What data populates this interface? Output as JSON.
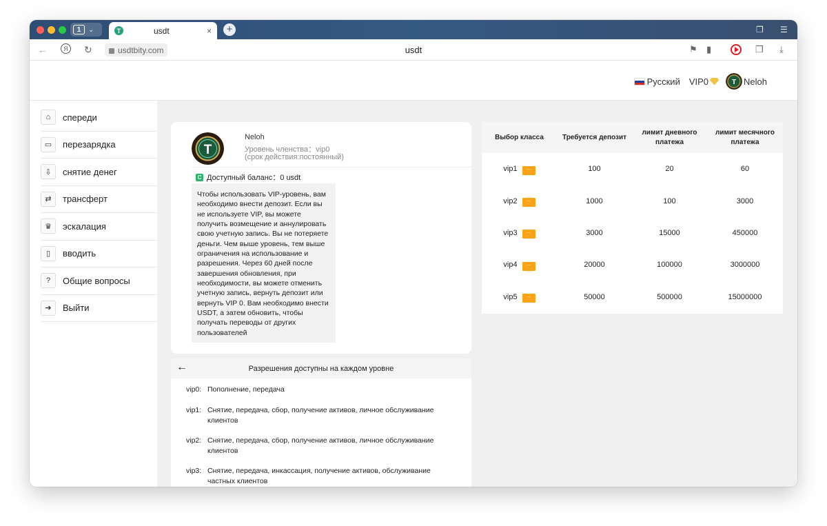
{
  "browser": {
    "tab_count": "1",
    "tab_title": "usdt",
    "tab_close": "×",
    "new_tab": "+",
    "url": "usdtbity.com",
    "center_title": "usdt"
  },
  "header": {
    "language": "Русский",
    "vip_level": "VIP0",
    "username": "Neloh"
  },
  "sidebar": {
    "items": [
      {
        "label": "спереди",
        "icon": "home-icon"
      },
      {
        "label": "перезарядка",
        "icon": "wallet-icon"
      },
      {
        "label": "снятие денег",
        "icon": "tray-download-icon"
      },
      {
        "label": "трансферт",
        "icon": "transfer-icon"
      },
      {
        "label": "эскалация",
        "icon": "crown-icon"
      },
      {
        "label": "вводить",
        "icon": "document-icon"
      },
      {
        "label": "Общие вопросы",
        "icon": "question-icon"
      },
      {
        "label": "Выйти",
        "icon": "logout-icon"
      }
    ]
  },
  "profile": {
    "name": "Neloh",
    "level": "Уровень членства：vip0",
    "expiry": "(срок действия:постоянный)",
    "balance": "Доступный баланс：0 usdt",
    "info": "Чтобы использовать VIP-уровень, вам необходимо внести депозит. Если вы не используете VIP, вы можете получить возмещение и аннулировать свою учетную запись. Вы не потеряете деньги. Чем выше уровень, тем выше ограничения на использование и разрешения. Через 60 дней после завершения обновления, при необходимости, вы можете отменить учетную запись, вернуть депозит или вернуть VIP 0. Вам необходимо внести USDT, а затем обновить, чтобы получать переводы от других пользователей"
  },
  "permissions": {
    "title": "Разрешения доступны на каждом уровне",
    "rows": [
      {
        "level": "vip0:",
        "text": "Пополнение, передача"
      },
      {
        "level": "vip1:",
        "text": "Снятие, передача, сбор, получение активов, личное обслуживание клиентов"
      },
      {
        "level": "vip2:",
        "text": "Снятие, передача, сбор, получение активов, личное обслуживание клиентов"
      },
      {
        "level": "vip3:",
        "text": "Снятие, передача, инкассация, получение активов, обслуживание частных клиентов"
      }
    ]
  },
  "vip_table": {
    "headers": [
      "Выбор класса",
      "Требуется депозит",
      "лимит дневного платежа",
      "лимит месячного платежа"
    ],
    "button_label": "...",
    "rows": [
      {
        "level": "vip1",
        "deposit": "100",
        "daily": "20",
        "monthly": "60"
      },
      {
        "level": "vip2",
        "deposit": "1000",
        "daily": "100",
        "monthly": "3000"
      },
      {
        "level": "vip3",
        "deposit": "3000",
        "daily": "15000",
        "monthly": "450000"
      },
      {
        "level": "vip4",
        "deposit": "20000",
        "daily": "100000",
        "monthly": "3000000"
      },
      {
        "level": "vip5",
        "deposit": "50000",
        "daily": "500000",
        "monthly": "15000000"
      }
    ]
  },
  "colors": {
    "accent": "#f9a418",
    "tether": "#26a17b",
    "page_bg": "#f0f0f0"
  }
}
